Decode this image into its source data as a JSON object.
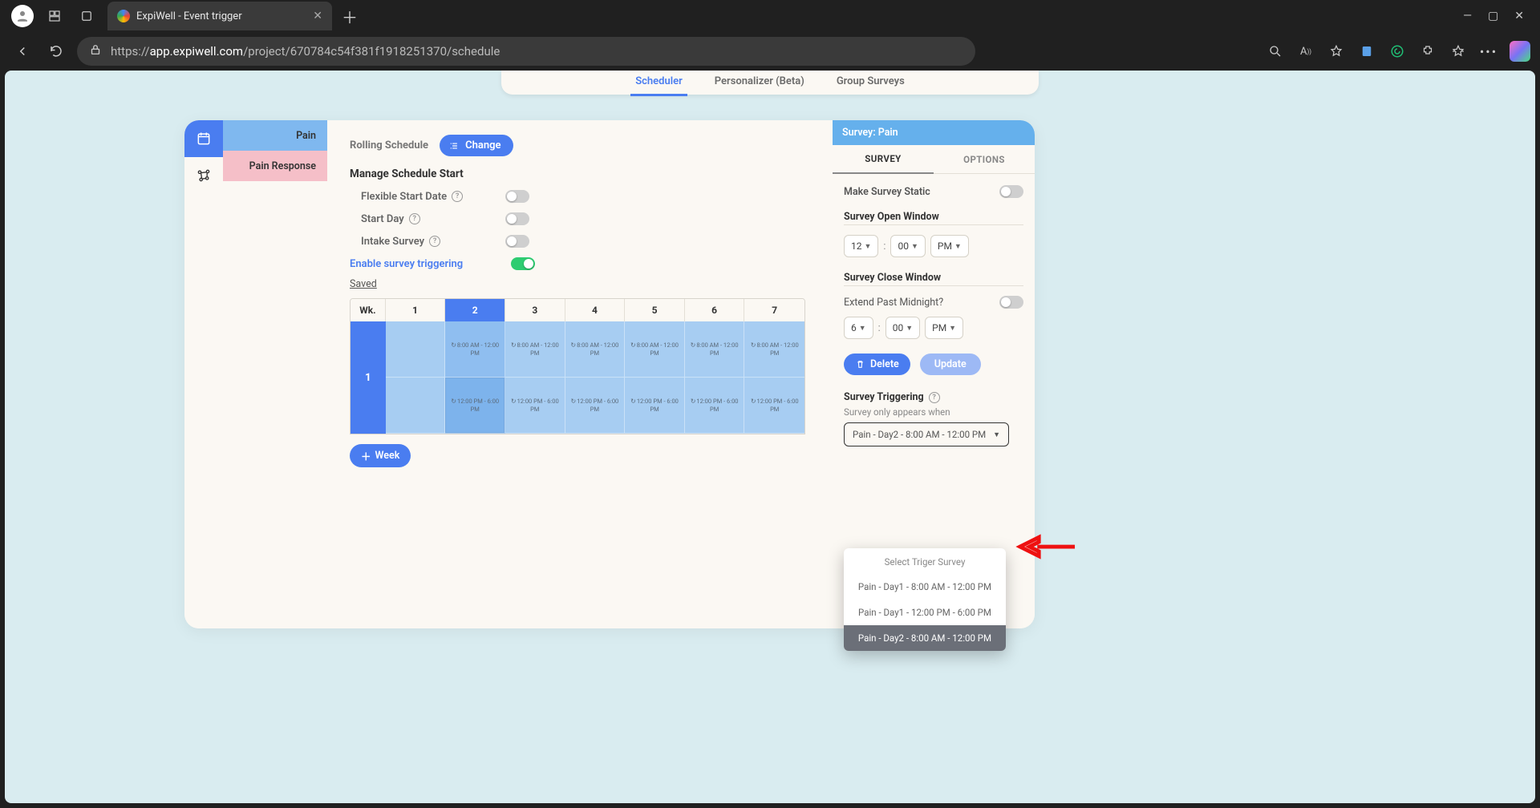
{
  "browser": {
    "tab_title": "ExpiWell - Event trigger",
    "url_prefix": "https://",
    "url_domain": "app.expiwell.com",
    "url_path": "/project/670784c54f381f1918251370/schedule"
  },
  "top_tabs": {
    "scheduler": "Scheduler",
    "personalizer": "Personalizer (Beta)",
    "group": "Group Surveys"
  },
  "survey_list": {
    "items": [
      "Pain",
      "Pain Response"
    ]
  },
  "center": {
    "rolling_label": "Rolling Schedule",
    "change_btn": "Change",
    "manage_head": "Manage Schedule Start",
    "flexible": "Flexible Start Date",
    "start_day": "Start Day",
    "intake": "Intake Survey",
    "enable_trigger": "Enable survey triggering",
    "saved": "Saved",
    "wk_label": "Wk.",
    "days": [
      "1",
      "2",
      "3",
      "4",
      "5",
      "6",
      "7"
    ],
    "week_num": "1",
    "slot_am": "8:00 AM - 12:00 PM",
    "slot_pm": "12:00 PM - 6:00 PM",
    "add_week": "Week"
  },
  "right": {
    "header": "Survey: Pain",
    "tab_survey": "SURVEY",
    "tab_options": "OPTIONS",
    "make_static": "Make Survey Static",
    "open_window": "Survey Open Window",
    "open_h": "12",
    "open_m": "00",
    "open_ap": "PM",
    "close_window": "Survey Close Window",
    "extend_midnight": "Extend Past Midnight?",
    "close_h": "6",
    "close_m": "00",
    "close_ap": "PM",
    "delete_btn": "Delete",
    "update_btn": "Update",
    "triggering": "Survey Triggering",
    "only_appears": "Survey only appears when",
    "selected_trigger": "Pain - Day2 - 8:00 AM - 12:00 PM"
  },
  "dropdown": {
    "title": "Select Triger Survey",
    "items": [
      "Pain - Day1 - 8:00 AM - 12:00 PM",
      "Pain - Day1 - 12:00 PM - 6:00 PM",
      "Pain - Day2 - 8:00 AM - 12:00 PM"
    ],
    "selected_index": 2
  }
}
